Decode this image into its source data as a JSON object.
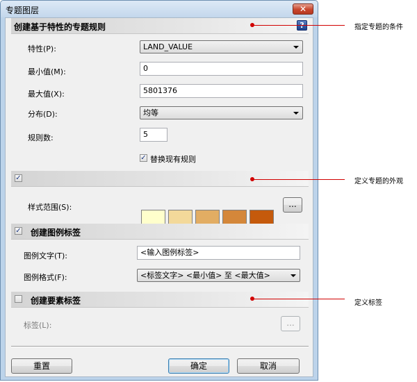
{
  "window": {
    "title": "专题图层",
    "close_glyph": "✕"
  },
  "rule_section": {
    "title": "创建基于特性的专题规则",
    "help_glyph": "?",
    "property_label": "特性(P):",
    "property_value": "LAND_VALUE",
    "min_label": "最小值(M):",
    "min_value": "0",
    "max_label": "最大值(X):",
    "max_value": "5801376",
    "distribution_label": "分布(D):",
    "distribution_value": "均等",
    "rule_count_label": "规则数:",
    "rule_count_value": "5",
    "replace_label": "替换现有规则",
    "replace_checked": true
  },
  "style_section": {
    "checked": true,
    "range_label": "样式范围(S):",
    "swatches": [
      "#ffffcc",
      "#f3d99a",
      "#e2ad63",
      "#d4873a",
      "#c55a0c"
    ],
    "more_label": "..."
  },
  "legend_section": {
    "title": "创建图例标签",
    "checked": true,
    "text_label": "图例文字(T):",
    "text_value": "<输入图例标签>",
    "format_label": "图例格式(F):",
    "format_value": "<标签文字> <最小值> 至 <最大值>"
  },
  "feature_label_section": {
    "title": "创建要素标签",
    "checked": false,
    "label_label": "标签(L):",
    "more_label": "..."
  },
  "buttons": {
    "reset": "重置",
    "ok": "确定",
    "cancel": "取消"
  },
  "annotations": [
    "指定专题的条件",
    "定义专题的外观",
    "定义标签"
  ],
  "colors": {
    "annotation": "#d10000",
    "dialog_frame": "#bcd3ea"
  }
}
